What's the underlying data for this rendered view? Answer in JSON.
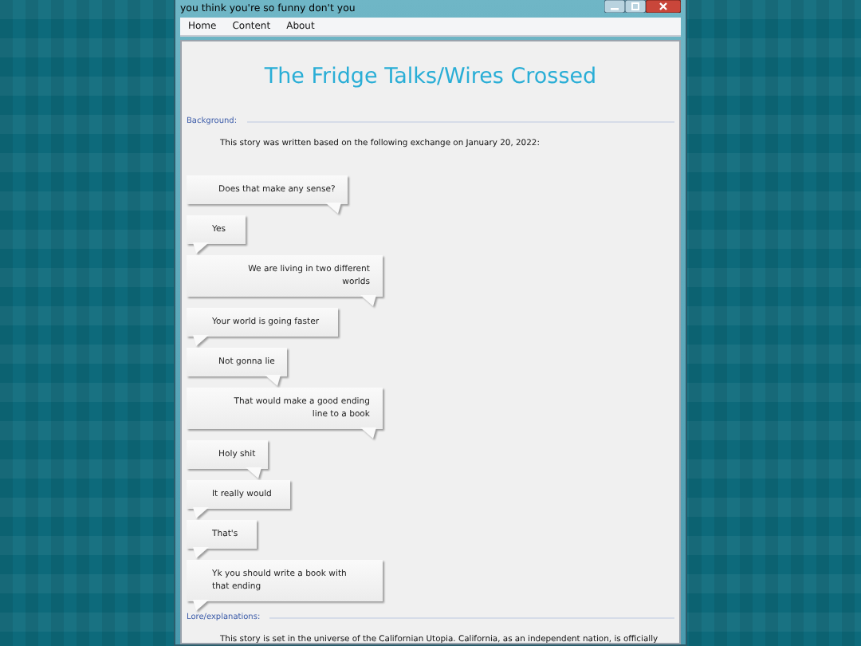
{
  "window": {
    "title": "you think you're so funny don't you"
  },
  "menu": [
    {
      "label": "Home"
    },
    {
      "label": "Content"
    },
    {
      "label": "About"
    }
  ],
  "page": {
    "title": "The Fridge Talks/Wires Crossed",
    "sections": [
      {
        "heading": "Background:",
        "intro": "This story was written based on the following exchange on January 20, 2022:",
        "messages": [
          {
            "text": "Does that make any sense?",
            "kind": "sent"
          },
          {
            "text": "Yes",
            "kind": "received"
          },
          {
            "text": "We are living in two different worlds",
            "kind": "sent"
          },
          {
            "text": "Your world is going faster",
            "kind": "received"
          },
          {
            "text": "Not gonna lie",
            "kind": "sent"
          },
          {
            "text": "That would make a good ending line to a book",
            "kind": "sent"
          },
          {
            "text": "Holy shit",
            "kind": "sent"
          },
          {
            "text": "It really would",
            "kind": "received"
          },
          {
            "text": "That's",
            "kind": "received"
          },
          {
            "text": "Yk you should write a book with that ending",
            "kind": "received"
          }
        ]
      },
      {
        "heading": "Lore/explanations:",
        "intro": "This story is set in the universe of the Californian Utopia. California, as an independent nation, is officially"
      }
    ]
  }
}
